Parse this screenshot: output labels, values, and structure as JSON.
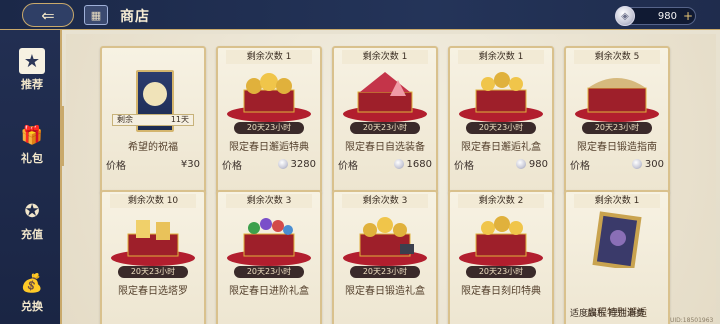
{
  "topbar": {
    "title": "商店",
    "currency_amount": "980",
    "currency_plus": "+"
  },
  "sidebar": {
    "items": [
      {
        "label": "推荐",
        "icon": "star-icon",
        "active": true
      },
      {
        "label": "礼包",
        "icon": "gift-icon",
        "active": false
      },
      {
        "label": "充值",
        "icon": "star-badge-icon",
        "active": false
      },
      {
        "label": "兑换",
        "icon": "exchange-bag-icon",
        "active": false
      }
    ]
  },
  "cards": [
    {
      "banner": "",
      "remain_label": "剩余",
      "remain_days": "11天",
      "timer": "",
      "name": "希望的祝福",
      "price_label": "价格",
      "price": "¥30",
      "currency": "yuan"
    },
    {
      "banner": "剩余次数 1",
      "timer": "20天23小时",
      "name": "限定春日邂逅特典",
      "price_label": "价格",
      "price": "3280",
      "currency": "coin"
    },
    {
      "banner": "剩余次数 1",
      "timer": "20天23小时",
      "name": "限定春日自选装备",
      "price_label": "价格",
      "price": "1680",
      "currency": "coin"
    },
    {
      "banner": "剩余次数 1",
      "timer": "20天23小时",
      "name": "限定春日邂逅礼盒",
      "price_label": "价格",
      "price": "980",
      "currency": "coin"
    },
    {
      "banner": "剩余次数 5",
      "timer": "20天23小时",
      "name": "限定春日锻造指南",
      "price_label": "价格",
      "price": "300",
      "currency": "coin"
    },
    {
      "banner": "剩余次数 10",
      "timer": "20天23小时",
      "name": "限定春日选塔罗",
      "price_label": "",
      "price": "",
      "currency": ""
    },
    {
      "banner": "剩余次数 3",
      "timer": "20天23小时",
      "name": "限定春日进阶礼盒",
      "price_label": "",
      "price": "",
      "currency": ""
    },
    {
      "banner": "剩余次数 3",
      "timer": "20天23小时",
      "name": "限定春日锻造礼盒",
      "price_label": "",
      "price": "",
      "currency": ""
    },
    {
      "banner": "剩余次数 2",
      "timer": "20天23小时",
      "name": "限定春日刻印特典",
      "price_label": "",
      "price": "",
      "currency": ""
    },
    {
      "banner": "剩余次数 1",
      "timer": "",
      "name": "启程特别邂逅",
      "price_label": "",
      "price": "",
      "currency": ""
    }
  ],
  "footer": {
    "notice": "适度娱乐 理性消费",
    "uid": "UID:18501963"
  },
  "colors": {
    "topbar_bg": "#1b2848",
    "gold_border": "#c9a96b",
    "card_bg": "#f7f2e3",
    "chest_red": "#9e1f2a",
    "gold": "#e0b13c"
  }
}
